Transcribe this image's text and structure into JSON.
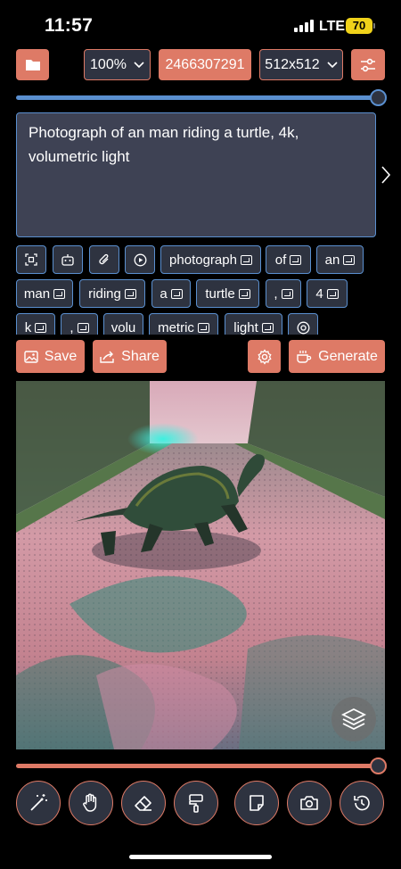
{
  "status": {
    "time": "11:57",
    "network": "LTE",
    "battery": "70"
  },
  "toolbar": {
    "zoom": "100%",
    "seed": "2466307291",
    "size": "512x512"
  },
  "prompt": {
    "text": "Photograph of an man riding a turtle, 4k, volumetric light"
  },
  "tokens": [
    "photograph",
    "of",
    "an",
    "man",
    "riding",
    "a",
    "turtle",
    ",",
    "4",
    "k",
    ",",
    "volu",
    "metric",
    "light"
  ],
  "actions": {
    "save": "Save",
    "share": "Share",
    "generate": "Generate"
  },
  "sliders": {
    "top_value": 1.0,
    "bottom_value": 1.0
  },
  "colors": {
    "accent": "#de7a66",
    "blue": "#5a8fcf",
    "panel": "#2e3340",
    "prompt_bg": "#3e4254"
  },
  "icons": {
    "folder": "folder-icon",
    "settings": "sliders-icon",
    "gear": "gear-icon",
    "image": "image-icon",
    "share": "share-icon",
    "generate": "cup-icon",
    "layers": "layers-icon",
    "tools": [
      "magic-wand-icon",
      "hand-icon",
      "eraser-icon",
      "paint-roller-icon",
      "sticky-note-icon",
      "camera-icon",
      "history-icon"
    ]
  }
}
